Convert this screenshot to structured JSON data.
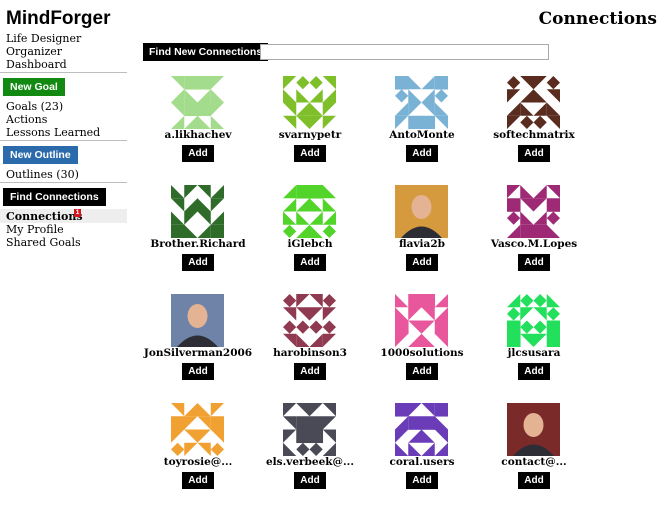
{
  "app": {
    "title": "MindForger"
  },
  "sidebar": {
    "links_top": [
      "Life Designer",
      "Organizer",
      "Dashboard"
    ],
    "new_goal": {
      "label": "New Goal",
      "color": "#128a12"
    },
    "goal_links": [
      "Goals (23)",
      "Actions",
      "Lessons Learned"
    ],
    "new_outline": {
      "label": "New Outline",
      "color": "#2c6bab"
    },
    "outline_links": [
      "Outlines (30)"
    ],
    "find_connections": {
      "label": "Find Connections",
      "color": "#000000"
    },
    "connections": {
      "label": "Connections",
      "badge": "1"
    },
    "profile_links": [
      "My Profile",
      "Shared Goals"
    ]
  },
  "header": {
    "title": "Connections"
  },
  "search": {
    "button_label": "Find New Connections",
    "value": "",
    "placeholder": ""
  },
  "add_label": "Add",
  "connections": [
    {
      "name": "a.likhachev",
      "avatar": "identicon",
      "color": "#a3dc8c"
    },
    {
      "name": "svarnypetr",
      "avatar": "identicon",
      "color": "#7fbf2a"
    },
    {
      "name": "AntoMonte",
      "avatar": "identicon",
      "color": "#7ab2d6"
    },
    {
      "name": "softechmatrix",
      "avatar": "identicon",
      "color": "#5a2b1f"
    },
    {
      "name": "Brother.Richard",
      "avatar": "identicon",
      "color": "#2f6c2a"
    },
    {
      "name": "iGlebch",
      "avatar": "identicon",
      "color": "#52d42a"
    },
    {
      "name": "flavia2b",
      "avatar": "photo",
      "color": "#d59a3e"
    },
    {
      "name": "Vasco.M.Lopes",
      "avatar": "identicon",
      "color": "#9e2a76"
    },
    {
      "name": "JonSilverman2006",
      "avatar": "photo",
      "color": "#6f82a8"
    },
    {
      "name": "harobinson3",
      "avatar": "identicon",
      "color": "#8f3a50"
    },
    {
      "name": "1000solutions",
      "avatar": "identicon",
      "color": "#e8579b"
    },
    {
      "name": "jlcsusara",
      "avatar": "identicon",
      "color": "#22e05c"
    },
    {
      "name": "toyrosie@...",
      "avatar": "identicon",
      "color": "#f0a132"
    },
    {
      "name": "els.verbeek@...",
      "avatar": "identicon",
      "color": "#4a4a56"
    },
    {
      "name": "coral.users",
      "avatar": "identicon",
      "color": "#6a3cb8"
    },
    {
      "name": "contact@...",
      "avatar": "photo",
      "color": "#7b2a2a"
    }
  ]
}
